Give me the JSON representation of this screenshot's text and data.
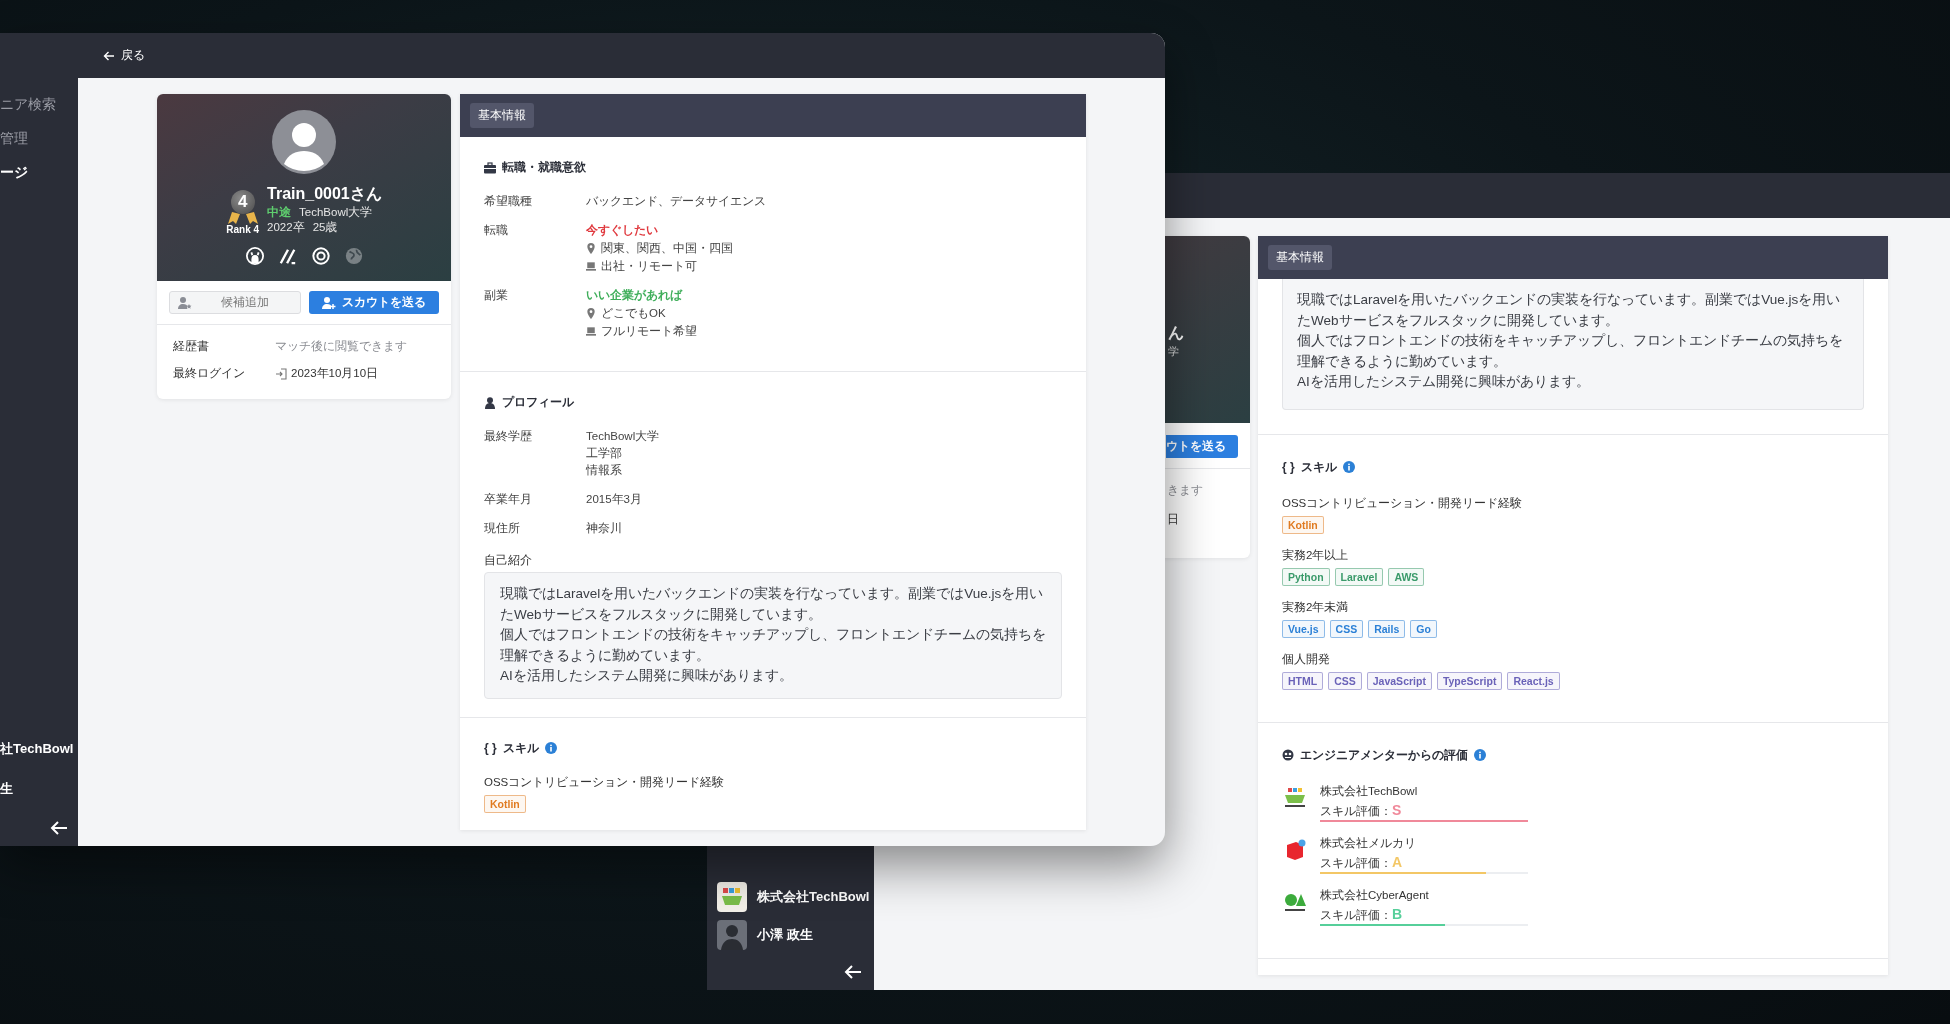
{
  "front_window": {
    "sidebar": {
      "items": [
        {
          "label": "ニア検索",
          "selected": false
        },
        {
          "label": "管理",
          "selected": false
        },
        {
          "label": "ージ",
          "selected": true
        }
      ],
      "company": "社TechBowl",
      "user": "生"
    },
    "back_link": "戻る",
    "profile": {
      "rank_number": "4",
      "rank_label": "Rank 4",
      "name": "Train_0001さん",
      "career_type": "中途",
      "school": "TechBowl大学",
      "graduation": "2022卒",
      "age": "25歳",
      "social_links": [
        {
          "kind": "github",
          "enabled": true
        },
        {
          "kind": "slash",
          "enabled": true
        },
        {
          "kind": "at",
          "enabled": true
        },
        {
          "kind": "globe",
          "enabled": false
        }
      ],
      "candidate_button": "候補追加",
      "scout_button": "スカウトを送る",
      "details": [
        {
          "label": "経歴書",
          "value": "マッチ後に閲覧できます",
          "kind": "muted"
        },
        {
          "label": "最終ログイン",
          "value": "2023年10月10日",
          "kind": "login"
        }
      ]
    },
    "info": {
      "tab": "基本情報",
      "intent": {
        "title": "転職・就職意欲",
        "rows": [
          {
            "label": "希望職種",
            "kind": "plain",
            "value": "バックエンド、データサイエンス"
          },
          {
            "label": "転職",
            "kind": "status",
            "status": "今すぐしたい",
            "color": "#e0393e",
            "location": "関東、関西、中国・四国",
            "work_style": "出社・リモート可"
          },
          {
            "label": "副業",
            "kind": "status",
            "status": "いい企業があれば",
            "color": "#3fae5a",
            "location": "どこでもOK",
            "work_style": "フルリモート希望"
          }
        ]
      },
      "profile": {
        "title": "プロフィール",
        "rows": [
          {
            "label": "最終学歴",
            "lines": [
              "TechBowl大学",
              "工学部",
              "情報系"
            ]
          },
          {
            "label": "卒業年月",
            "lines": [
              "2015年3月"
            ]
          },
          {
            "label": "現住所",
            "lines": [
              "神奈川"
            ]
          }
        ],
        "intro_label": "自己紹介",
        "intro": [
          "現職ではLaravelを用いたバックエンドの実装を行なっています。副業ではVue.jsを用いたWebサービスをフルスタックに開発しています。",
          "個人ではフロントエンドの技術をキャッチアップし、フロントエンドチームの気持ちを理解できるように勤めています。",
          "AIを活用したシステム開発に興味があります。"
        ]
      },
      "skills": {
        "icon": "{ }",
        "title": "スキル",
        "groups": [
          {
            "label": "OSSコントリビューション・開発リード経験",
            "color": "#e07b22",
            "tags": [
              "Kotlin"
            ]
          }
        ]
      }
    }
  },
  "back_window": {
    "profile_fragments": {
      "name": "ん",
      "school": "学",
      "scout_button": "ウトを送る",
      "resume": "きます",
      "login": "日"
    },
    "sidebar": {
      "company": "株式会社TechBowl",
      "user": "小澤 政生"
    },
    "info": {
      "tab": "基本情報",
      "intro": [
        "現職ではLaravelを用いたバックエンドの実装を行なっています。副業ではVue.jsを用いたWebサービスをフルスタックに開発しています。",
        "個人ではフロントエンドの技術をキャッチアップし、フロントエンドチームの気持ちを理解できるように勤めています。",
        "AIを活用したシステム開発に興味があります。"
      ],
      "skills": {
        "icon": "{ }",
        "title": "スキル",
        "groups": [
          {
            "label": "OSSコントリビューション・開発リード経験",
            "color": "#e07b22",
            "tags": [
              "Kotlin"
            ]
          },
          {
            "label": "実務2年以上",
            "color": "#3a9a6a",
            "tags": [
              "Python",
              "Laravel",
              "AWS"
            ]
          },
          {
            "label": "実務2年未満",
            "color": "#2b80d6",
            "tags": [
              "Vue.js",
              "CSS",
              "Rails",
              "Go"
            ]
          },
          {
            "label": "個人開発",
            "color": "#6a62b8",
            "tags": [
              "HTML",
              "CSS",
              "JavaScript",
              "TypeScript",
              "React.js"
            ]
          }
        ]
      },
      "evaluations": {
        "title": "エンジニアメンターからの評価",
        "items": [
          {
            "company": "株式会社TechBowl",
            "kind": "blocks",
            "grade_label": "スキル評価：",
            "grade": "S",
            "color": "#f0899a",
            "level": 1.0
          },
          {
            "company": "株式会社メルカリ",
            "kind": "box",
            "grade_label": "スキル評価：",
            "grade": "A",
            "color": "#f3c766",
            "level": 0.8
          },
          {
            "company": "株式会社CyberAgent",
            "kind": "leaf",
            "grade_label": "スキル評価：",
            "grade": "B",
            "color": "#56cf9a",
            "level": 0.6
          }
        ]
      }
    }
  }
}
